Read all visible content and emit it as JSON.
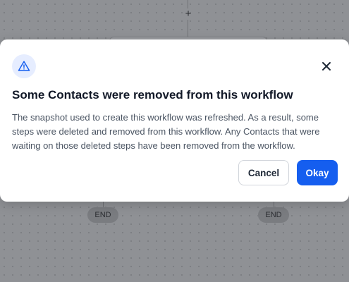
{
  "background": {
    "add_step_symbol": "+",
    "end_nodes": [
      "END",
      "END"
    ]
  },
  "dialog": {
    "icon": "warning-triangle-icon",
    "title": "Some Contacts were removed from this workflow",
    "message": "The snapshot used to create this workflow was refreshed. As a result, some steps were deleted and removed from this workflow. Any Contacts that were waiting on those deleted steps have been removed from the workflow.",
    "close_icon": "close-icon",
    "cancel_label": "Cancel",
    "okay_label": "Okay"
  },
  "colors": {
    "accent": "#155eef",
    "icon_background": "#e6edff",
    "overlay": "#8f9195"
  }
}
